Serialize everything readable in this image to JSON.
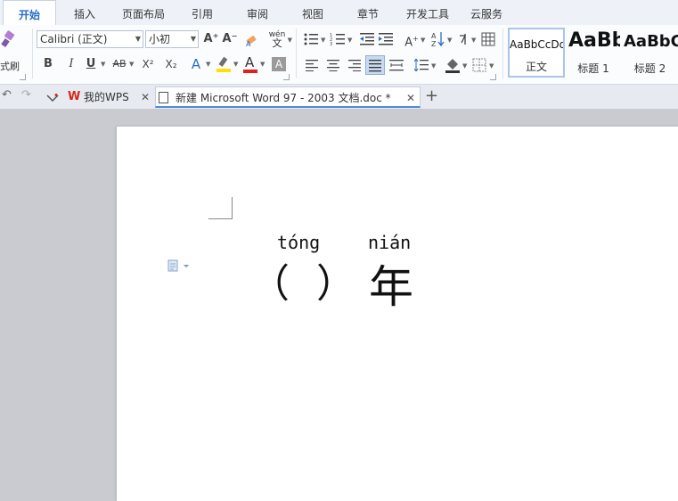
{
  "menu": {
    "tabs": [
      "开始",
      "插入",
      "页面布局",
      "引用",
      "审阅",
      "视图",
      "章节",
      "开发工具",
      "云服务"
    ],
    "active": "开始"
  },
  "ribbon": {
    "format_painter_label": "式刷",
    "font_name": "Calibri (正文)",
    "font_size": "小初",
    "bold": "B",
    "italic": "I",
    "underline": "U",
    "strikethrough": "AB",
    "superscript": "X²",
    "subscript": "X₂",
    "grow_font": "A⁺",
    "shrink_font": "A⁻",
    "phonetic_guide": "wén",
    "styles": [
      {
        "sample": "AaBbCcDd",
        "name": "正文"
      },
      {
        "sample": "AaBb",
        "name": "标题 1"
      },
      {
        "sample": "AaBbC",
        "name": "标题 2"
      }
    ]
  },
  "doc_tabs": [
    {
      "label": "我的WPS",
      "icon": "wps-logo-icon"
    },
    {
      "label": "新建 Microsoft Word 97 - 2003 文档.doc *",
      "icon": "document-icon"
    }
  ],
  "document": {
    "pinyin_1": "tóng",
    "pinyin_2": "nián",
    "open_paren": "（",
    "close_paren": "）",
    "character": "年"
  },
  "colors": {
    "accent": "#2b6cc5",
    "wps_red": "#d9261c",
    "font_color_bar": "#e02020",
    "highlight_bar": "#ffe000"
  }
}
